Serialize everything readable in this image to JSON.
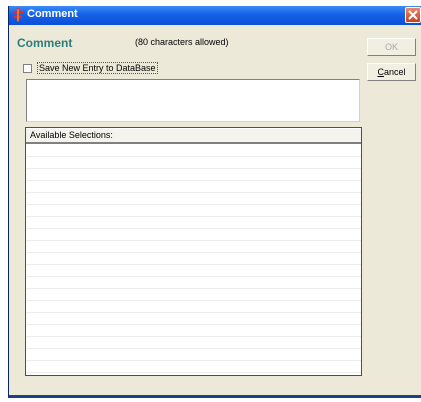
{
  "window": {
    "title": "Comment",
    "close_label": "Close"
  },
  "form": {
    "heading": "Comment",
    "char_limit_note": "(80 characters allowed)",
    "save_checkbox_label": "Save New Entry to DataBase",
    "save_checked": false,
    "comment_text": ""
  },
  "buttons": {
    "ok_label": "OK",
    "cancel_label": "Cancel",
    "ok_enabled": false
  },
  "list": {
    "header": "Available Selections:",
    "items": []
  },
  "colors": {
    "title_bar": "#1660e8",
    "heading": "#2e7d7d",
    "window_bg": "#ece9d8",
    "close_button": "#c8401f"
  }
}
